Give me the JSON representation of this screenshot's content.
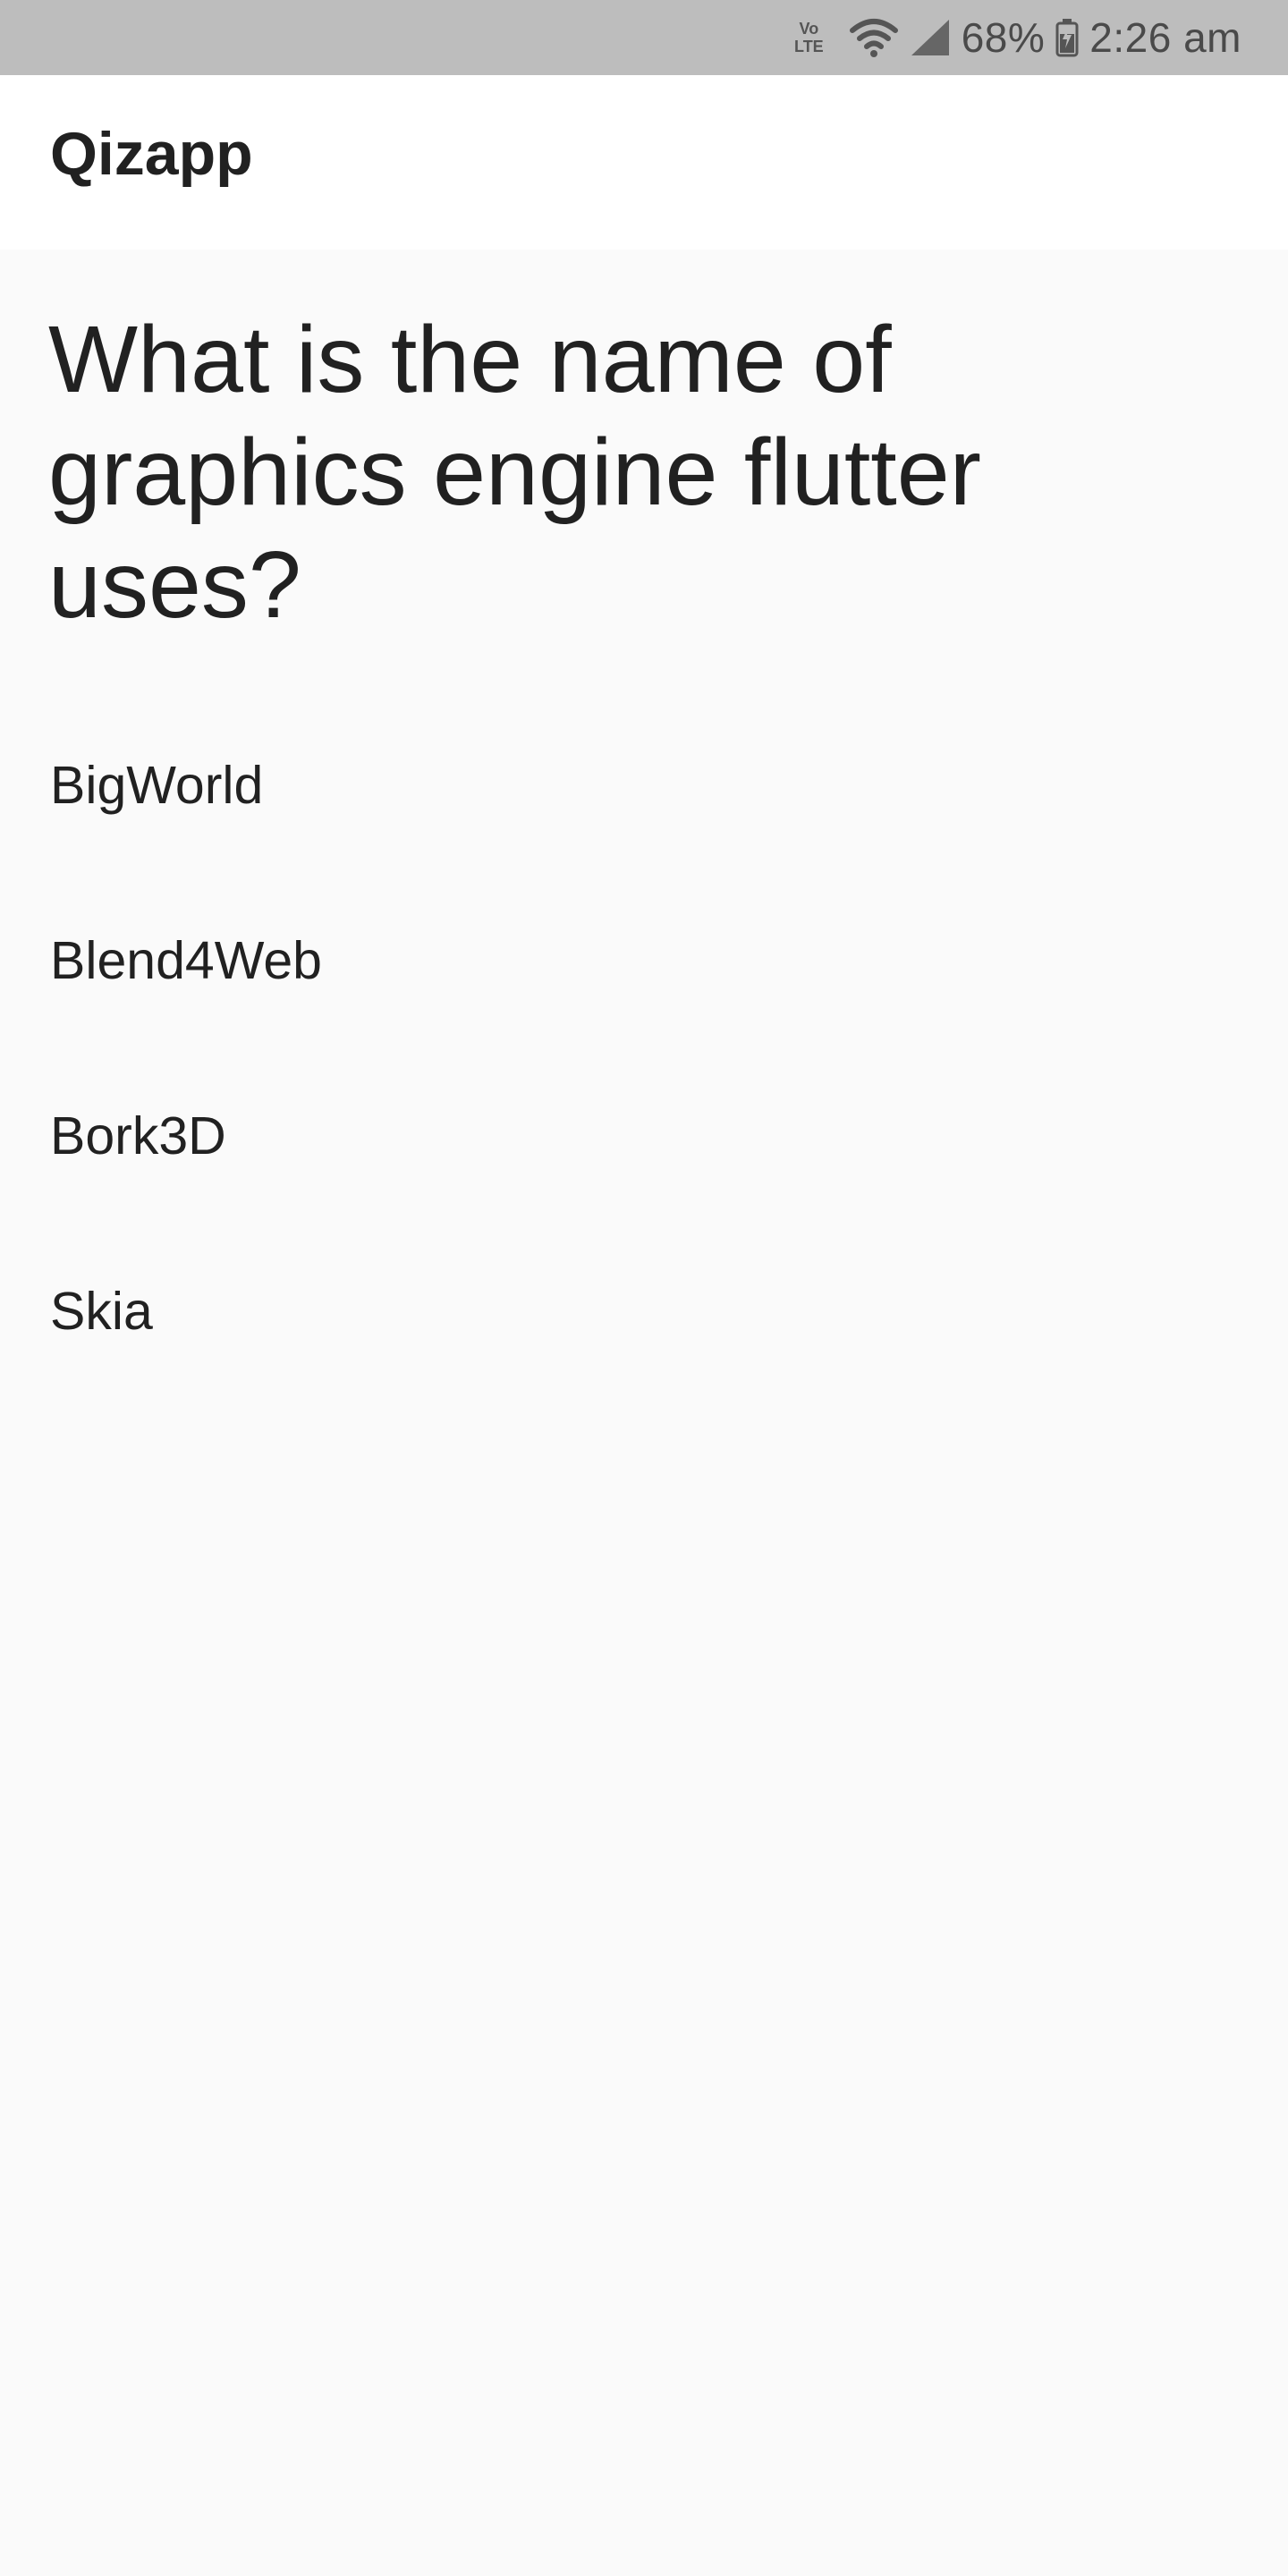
{
  "status_bar": {
    "network_label_top": "Vo",
    "network_label_bottom": "LTE",
    "wifi_icon": "wifi-icon",
    "signal_icon": "cell-signal-icon",
    "battery_percent": "68%",
    "battery_icon": "battery-charging-icon",
    "time": "2:26 am"
  },
  "app_bar": {
    "title": "Qizapp"
  },
  "quiz": {
    "question": "What is the name of graphics engine flutter uses?",
    "answers": [
      {
        "label": "BigWorld"
      },
      {
        "label": "Blend4Web"
      },
      {
        "label": "Bork3D"
      },
      {
        "label": "Skia"
      }
    ]
  },
  "colors": {
    "status_bar_bg": "#bdbdbd",
    "app_bar_bg": "#ffffff",
    "page_bg": "#fafafa",
    "text": "#212121"
  }
}
